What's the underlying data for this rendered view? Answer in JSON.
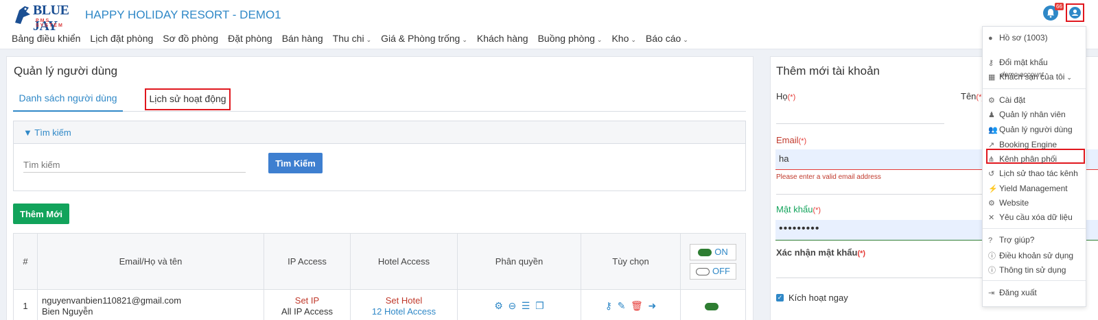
{
  "header": {
    "logo_text": "BLUE JAY",
    "logo_sub": "PMS SYSTEM",
    "hotel_name": "HAPPY HOLIDAY RESORT - DEMO1",
    "notification_count": "66"
  },
  "nav": [
    {
      "label": "Bảng điều khiển",
      "has_dropdown": false
    },
    {
      "label": "Lịch đặt phòng",
      "has_dropdown": false
    },
    {
      "label": "Sơ đồ phòng",
      "has_dropdown": false
    },
    {
      "label": "Đặt phòng",
      "has_dropdown": false
    },
    {
      "label": "Bán hàng",
      "has_dropdown": false
    },
    {
      "label": "Thu chi",
      "has_dropdown": true
    },
    {
      "label": "Giá & Phòng trống",
      "has_dropdown": true
    },
    {
      "label": "Khách hàng",
      "has_dropdown": false
    },
    {
      "label": "Buồng phòng",
      "has_dropdown": true
    },
    {
      "label": "Kho",
      "has_dropdown": true
    },
    {
      "label": "Báo cáo",
      "has_dropdown": true
    }
  ],
  "left": {
    "title": "Quản lý người dùng",
    "tabs": [
      "Danh sách người dùng",
      "Lịch sử hoạt động"
    ],
    "search": {
      "header": "Tìm kiếm",
      "placeholder": "Tìm kiếm",
      "button": "Tìm Kiếm"
    },
    "add_button": "Thêm Mới",
    "table": {
      "headers": [
        "#",
        "Email/Họ và tên",
        "IP Access",
        "Hotel Access",
        "Phân quyền",
        "Tùy chọn"
      ],
      "toggle_on": "ON",
      "toggle_off": "OFF",
      "rows": [
        {
          "index": "1",
          "email": "nguyenvanbien110821@gmail.com",
          "name": "Bien Nguyễn",
          "ip_link": "Set IP",
          "ip_value": "All IP Access",
          "hotel_link": "Set Hotel",
          "hotel_value": "12 Hotel Access"
        }
      ]
    }
  },
  "right": {
    "title": "Thêm mới tài khoản",
    "ho_label": "Họ",
    "ten_label": "Tên",
    "required_mark": "(*)",
    "email_label": "Email",
    "email_value": "ha",
    "email_error": "Please enter a valid email address",
    "password_label": "Mật khẩu",
    "password_value": "•••••••••",
    "confirm_label": "Xác nhận mật khẩu",
    "activate_label": "Kích hoạt ngay"
  },
  "dropdown": {
    "profile": "Hồ sơ  (1003)",
    "profile_sub": "demo account",
    "items_group1": [
      "Đổi mật khẩu",
      "Khách sạn của tôi"
    ],
    "items_group2": [
      "Cài đặt",
      "Quản lý nhân viên",
      "Quản lý người dùng",
      "Booking Engine",
      "Kênh phân phối",
      "Lịch sử thao tác kênh",
      "Yield Management",
      "Website",
      "Yêu cầu xóa dữ liệu"
    ],
    "items_group3": [
      "Trợ giúp?",
      "Điều khoản sử dụng",
      "Thông tin sử dụng"
    ],
    "logout": "Đăng xuất"
  },
  "colors": {
    "brand_blue": "#2f88c7",
    "highlight_red": "#e0161d",
    "success_green": "#12a35b",
    "button_blue": "#3e7fd0"
  }
}
